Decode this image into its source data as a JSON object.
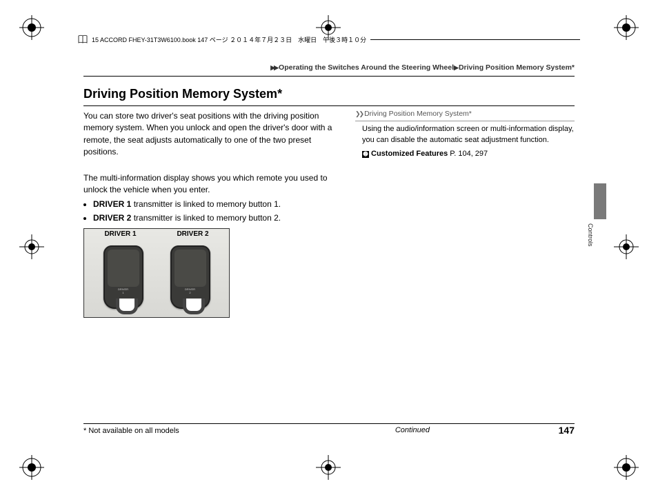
{
  "file_header": "15 ACCORD FHEY-31T3W6100.book  147 ページ  ２０１４年７月２３日　水曜日　午後３時１０分",
  "breadcrumb": {
    "arrows": "▶▶",
    "path1": "Operating the Switches Around the Steering Wheel",
    "sep": "▶",
    "path2": "Driving Position Memory System*"
  },
  "title": "Driving Position Memory System*",
  "body": {
    "p1": "You can store two driver's seat positions with the driving position memory system. When you unlock and open the driver's door with a remote, the seat adjusts automatically to one of the two preset positions.",
    "p2": "The multi-information display shows you which remote you used to unlock the vehicle when you enter.",
    "bullet1_bold": "DRIVER 1",
    "bullet1_rest": " transmitter is linked to memory button 1.",
    "bullet2_bold": "DRIVER 2",
    "bullet2_rest": " transmitter is linked to memory button 2.",
    "fig_label1": "DRIVER 1",
    "fig_label2": "DRIVER 2",
    "badge1a": "DRIVER",
    "badge1b": "1",
    "badge2a": "DRIVER",
    "badge2b": "2"
  },
  "sidebar": {
    "head_chev": "❯❯",
    "head": "Driving Position Memory System*",
    "text": "Using the audio/information screen or multi-information display, you can disable the automatic seat adjustment function.",
    "ref_icon": "➋",
    "ref_bold": "Customized Features",
    "ref_pages": " P. 104, 297"
  },
  "tab_label": "Controls",
  "footer": {
    "note": "* Not available on all models",
    "continued": "Continued",
    "page": "147"
  }
}
